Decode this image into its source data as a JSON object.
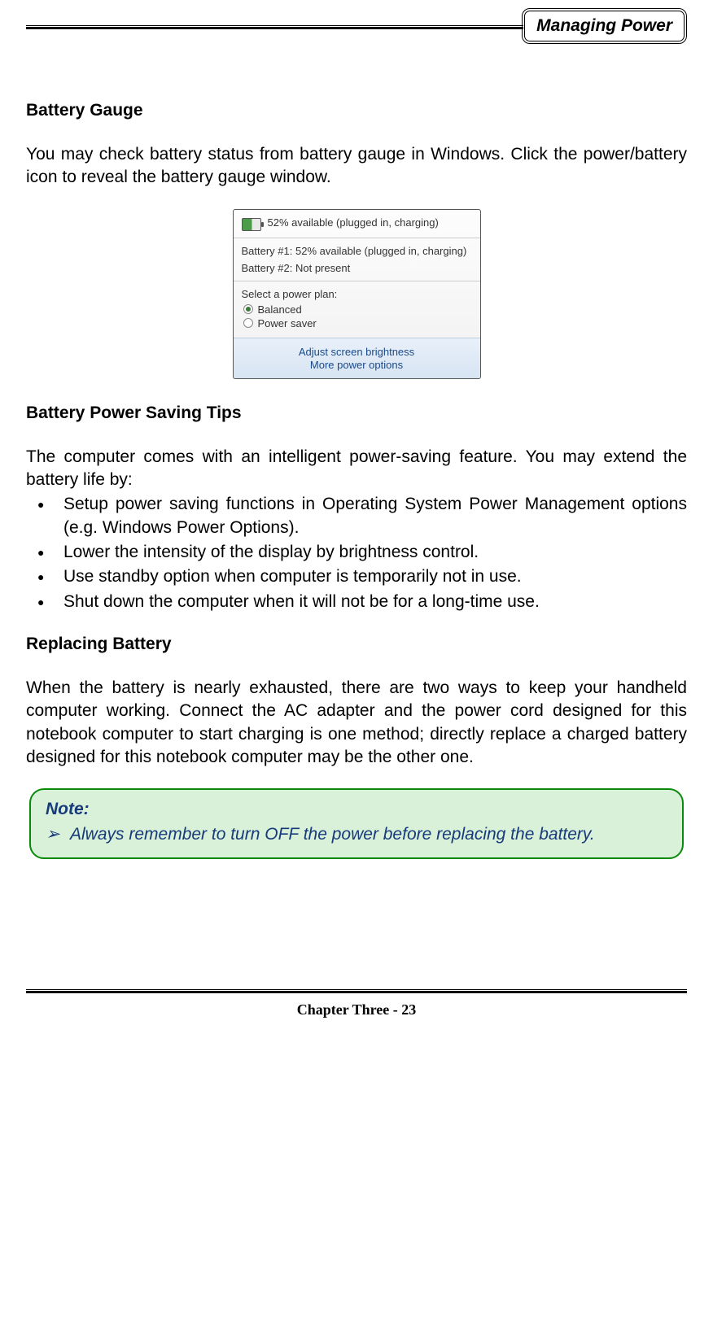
{
  "header": {
    "chapter_title": "Managing Power"
  },
  "sections": {
    "battery_gauge": {
      "heading": "Battery Gauge",
      "body": "You may check battery status from battery gauge in Windows. Click the power/battery icon to reveal the battery gauge window."
    },
    "popup": {
      "main_status": "52% available (plugged in, charging)",
      "battery1": "Battery #1: 52% available (plugged in, charging)",
      "battery2": "Battery #2: Not present",
      "plan_label": "Select a power plan:",
      "plan_balanced": "Balanced",
      "plan_saver": "Power saver",
      "link_brightness": "Adjust screen brightness",
      "link_more": "More power options"
    },
    "saving_tips": {
      "heading": "Battery Power Saving Tips",
      "intro": "The computer comes with an intelligent power-saving feature. You may extend the battery life by:",
      "bullets": [
        "Setup power saving functions in Operating System Power Management options (e.g. Windows Power Options).",
        "Lower the intensity of the display by brightness control.",
        "Use standby option when computer is temporarily not in use.",
        "Shut down the computer when it will not be for a long-time use."
      ]
    },
    "replacing": {
      "heading": "Replacing Battery",
      "body": "When the battery is nearly exhausted, there are two ways to keep your handheld computer working. Connect the AC adapter and the power cord designed for this notebook computer to start charging is one method; directly replace a charged battery designed for this notebook computer may be the other one."
    },
    "note": {
      "title": "Note:",
      "text": "Always remember to turn OFF the power before replacing the battery."
    }
  },
  "footer": {
    "text": "Chapter Three - 23"
  }
}
